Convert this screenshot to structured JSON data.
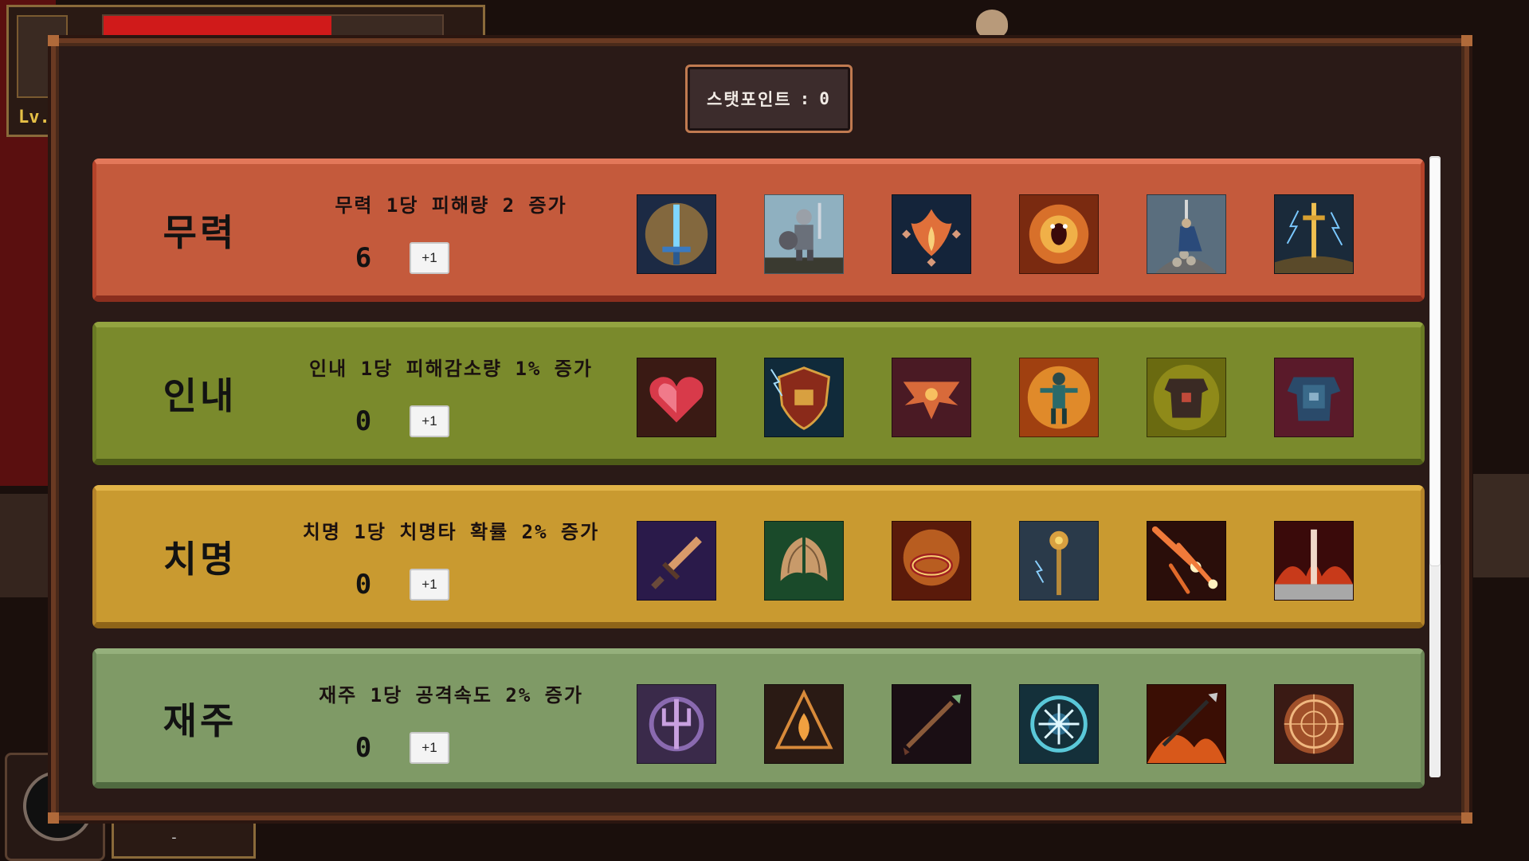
{
  "hud": {
    "level_label": "Lv.",
    "potion_count": "-"
  },
  "stat_points": {
    "label": "스탯포인트",
    "separator": ":",
    "value": "0"
  },
  "stats": [
    {
      "name": "무력",
      "description": "무력 1당 피해량 2 증가",
      "value": "6",
      "button": "+1",
      "skills": [
        "glowing-sword",
        "armored-knight",
        "flame-burst",
        "fire-demon",
        "sword-on-skulls",
        "lightning-sword"
      ]
    },
    {
      "name": "인내",
      "description": "인내 1당 피해감소량 1% 증가",
      "value": "0",
      "button": "+1",
      "skills": [
        "heart",
        "lightning-shield",
        "winged-emblem",
        "burning-warrior",
        "gold-armor",
        "blue-armor"
      ]
    },
    {
      "name": "치명",
      "description": "치명 1당 치명타 확률 2% 증가",
      "value": "0",
      "button": "+1",
      "skills": [
        "dagger",
        "green-wings",
        "fire-ring",
        "golden-mace",
        "meteor-shower",
        "fire-pillar"
      ]
    },
    {
      "name": "재주",
      "description": "재주 1당 공격속도 2% 증가",
      "value": "0",
      "button": "+1",
      "skills": [
        "purple-trident-sigil",
        "flame-sigil",
        "arrow",
        "frost-rune",
        "fire-arrow",
        "magic-circle"
      ]
    }
  ]
}
